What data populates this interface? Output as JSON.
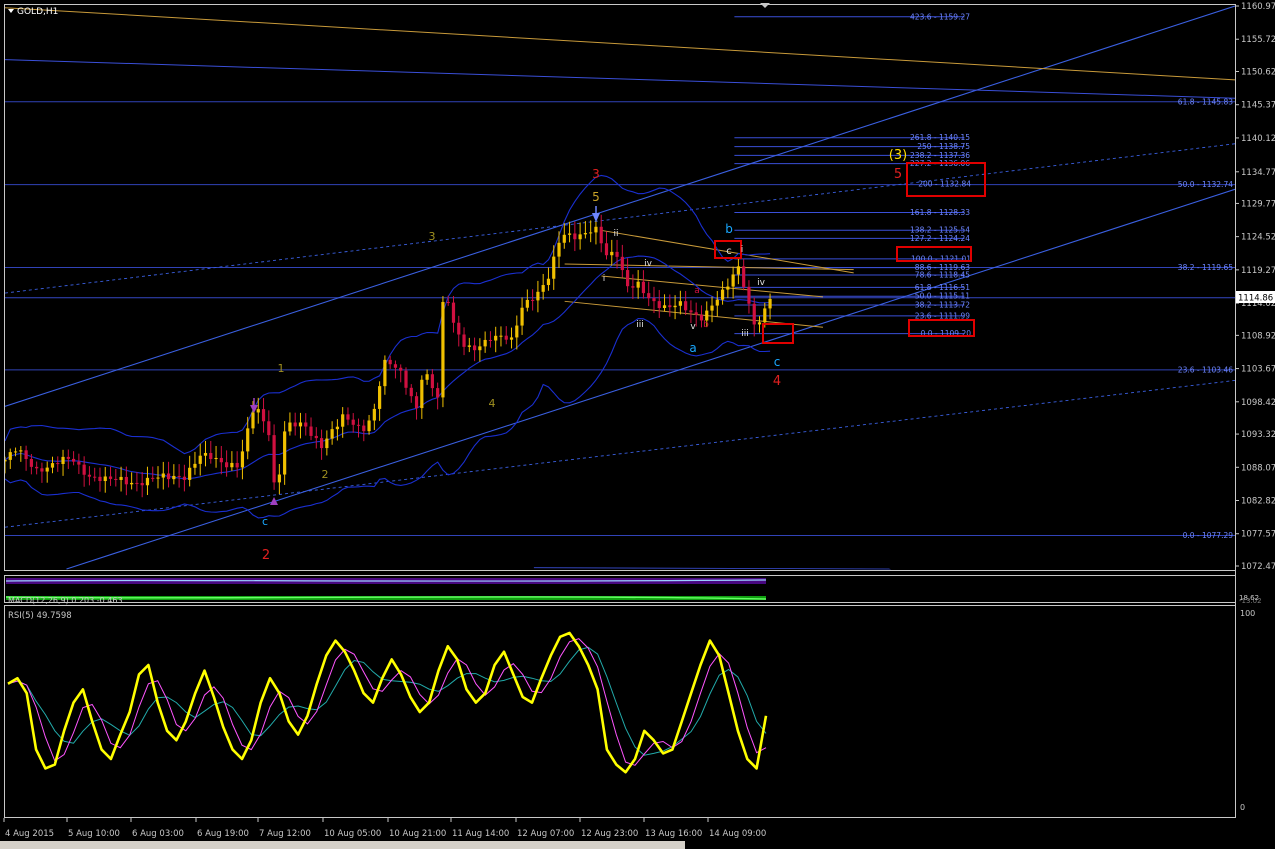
{
  "window": {
    "title": "GOLD,H1"
  },
  "colors": {
    "background": "#000000",
    "frame": "#c8c8c8",
    "bull_candle": "#f0c000",
    "bear_candle": "#d01040",
    "bands": "#1a2fd0",
    "fib_line": "#3a4fd8",
    "fib_text": "#6d86ff",
    "channel": "#3a5fe0",
    "trendline_orange": "#c89a3a",
    "highlight_box": "#e00000",
    "rsi_line": "#ffff00",
    "rsi_signal": "#ff55ff",
    "rsi_signal2": "#22aaaa",
    "price_label_bg": "#ffffff",
    "wave_red": "#e02020",
    "wave_yellow": "#c9a227",
    "wave_cyan": "#19a8ff",
    "wave_white": "#e0e0e0",
    "wave_olive": "#a09020"
  },
  "price_axis": {
    "ticks": [
      "1160.97",
      "1155.72",
      "1150.62",
      "1145.37",
      "1140.12",
      "1134.77",
      "1129.77",
      "1124.52",
      "1119.27",
      "1114.02",
      "1108.92",
      "1103.67",
      "1098.42",
      "1093.32",
      "1088.07",
      "1082.82",
      "1077.57",
      "1072.47"
    ],
    "current_price": "1114.86"
  },
  "time_axis": {
    "ticks": [
      "4 Aug 2015",
      "5 Aug 10:00",
      "6 Aug 03:00",
      "6 Aug 19:00",
      "7 Aug 12:00",
      "10 Aug 05:00",
      "10 Aug 21:00",
      "11 Aug 14:00",
      "12 Aug 07:00",
      "12 Aug 23:00",
      "13 Aug 16:00",
      "14 Aug 09:00"
    ]
  },
  "fib_levels": [
    "423.6 - 1159.27",
    "61.8 - 1145.83",
    "261.8 - 1140.15",
    "250 - 1138.75",
    "238.2 - 1137.36",
    "227.2 - 1136.06",
    "200 - 1132.84",
    "50.0 - 1132.74",
    "161.8 - 1128.33",
    "138.2 - 1125.54",
    "127.2 - 1124.24",
    "100.0 - 1121.01",
    "38.2 - 1119.65",
    "88.6 - 1119.63",
    "78.6 - 1118.45",
    "61.8 - 1116.51",
    "50.0 - 1115.11",
    "38.2 - 1113.72",
    "23.6 - 1111.99",
    "0.0 - 1109.20",
    "23.6 - 1103.46",
    "0.0 - 1077.29"
  ],
  "wave_labels": {
    "major_3": "3",
    "major_4": "4",
    "major_5": "5",
    "major_2": "2",
    "major_3_paren": "(3)",
    "y5": "5",
    "y3": "3",
    "y4": "4",
    "y2": "2",
    "y1": "1",
    "c_low": "c",
    "a": "a",
    "b": "b",
    "c_mid": "c",
    "sub_ii": "ii",
    "sub_i": "i",
    "sub_iv": "iv",
    "sub_iii": "iii",
    "sub_v": "v",
    "sub_a": "a",
    "sub_b": "b",
    "box_c": "c",
    "r_i": "i",
    "r_iv": "iv",
    "r_iii": "iii"
  },
  "macd": {
    "label": "MACD(12,26,9) 0.203 -0.463",
    "top": "18.62",
    "bottom": "-13.02"
  },
  "rsi": {
    "label": "RSI(5) 49.7598",
    "level_top": "100",
    "level_bottom": "0"
  },
  "chart_data": [
    {
      "type": "candlestick",
      "title": "GOLD,H1",
      "ylim": [
        1072.47,
        1160.97
      ],
      "current_price": 1114.86,
      "swing_points": [
        {
          "time": "4 Aug 2015",
          "price": 1089.5
        },
        {
          "time": "7 Aug 12:00",
          "price": 1082.5
        },
        {
          "time": "10 Aug 21:00",
          "price": 1118.5
        },
        {
          "time": "11 Aug 14:00",
          "price": 1102.5
        },
        {
          "time": "12 Aug 07:00",
          "price": 1125.5
        },
        {
          "time": "13 Aug 16:00",
          "price": 1110.5
        },
        {
          "time": "14 Aug 09:00",
          "price": 1119.8
        },
        {
          "time": "14 Aug 09:00",
          "price": 1112.0
        },
        {
          "time": "14 Aug 09:00",
          "price": 1114.86
        }
      ]
    },
    {
      "type": "line",
      "title": "RSI(5) 49.7598",
      "ylim": [
        0,
        100
      ],
      "series": [
        {
          "values": [
            65,
            68,
            60,
            30,
            20,
            22,
            40,
            55,
            62,
            45,
            30,
            25,
            38,
            50,
            70,
            75,
            55,
            40,
            35,
            45,
            60,
            72,
            58,
            42,
            30,
            25,
            35,
            55,
            68,
            60,
            45,
            38,
            48,
            65,
            80,
            88,
            82,
            72,
            60,
            55,
            68,
            78,
            70,
            58,
            50,
            55,
            72,
            85,
            78,
            62,
            55,
            60,
            75,
            82,
            70,
            58,
            55,
            68,
            80,
            90,
            92,
            85,
            75,
            62,
            30,
            22,
            18,
            25,
            40,
            35,
            28,
            30,
            45,
            60,
            75,
            88,
            80,
            60,
            40,
            25,
            20,
            48
          ]
        }
      ]
    }
  ]
}
